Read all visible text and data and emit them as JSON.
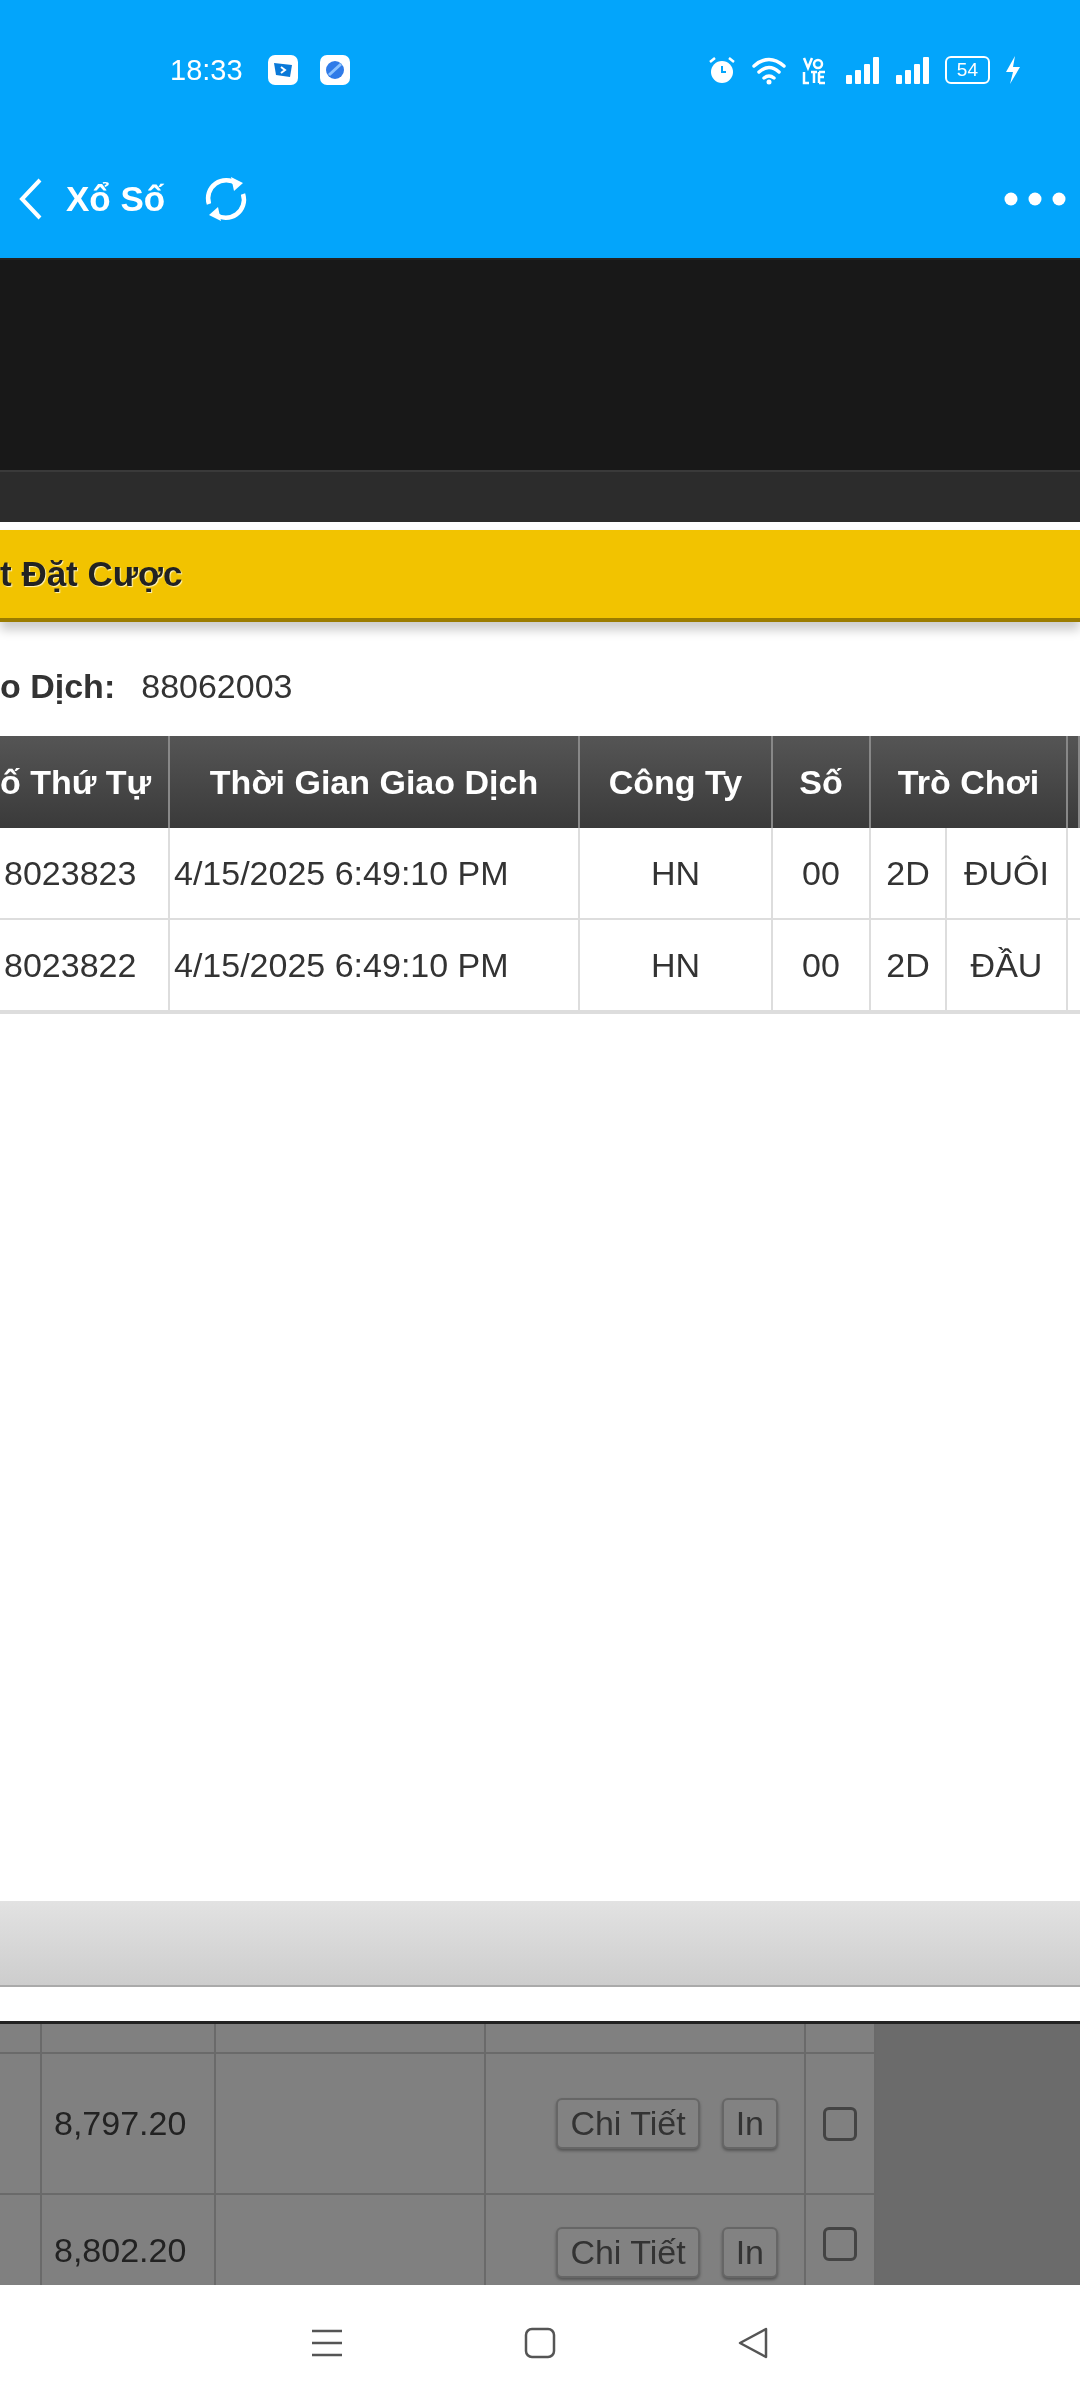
{
  "status_bar": {
    "time": "18:33",
    "battery": "54"
  },
  "header": {
    "title": "Xổ Số"
  },
  "section_bar": {
    "title": "t Đặt Cược"
  },
  "transaction": {
    "label": "o Dịch:",
    "value": "88062003"
  },
  "bets_table": {
    "columns": [
      "ố Thứ Tự",
      "Thời Gian Giao Dịch",
      "Công Ty",
      "Số",
      "Trò Chơi"
    ],
    "rows": [
      {
        "cells": [
          "8023823",
          "4/15/2025 6:49:10 PM",
          "HN",
          "00",
          "2D",
          "ĐUÔI"
        ]
      },
      {
        "cells": [
          "8023822",
          "4/15/2025 6:49:10 PM",
          "HN",
          "00",
          "2D",
          "ĐẦU"
        ]
      }
    ]
  },
  "history_table": {
    "rows": [
      {
        "amount": "8,797.20",
        "buttons": [
          "Chi Tiết",
          "In"
        ],
        "checked": false
      },
      {
        "amount": "8,802.20",
        "buttons": [
          "Chi Tiết",
          "In"
        ],
        "checked": false
      }
    ]
  }
}
